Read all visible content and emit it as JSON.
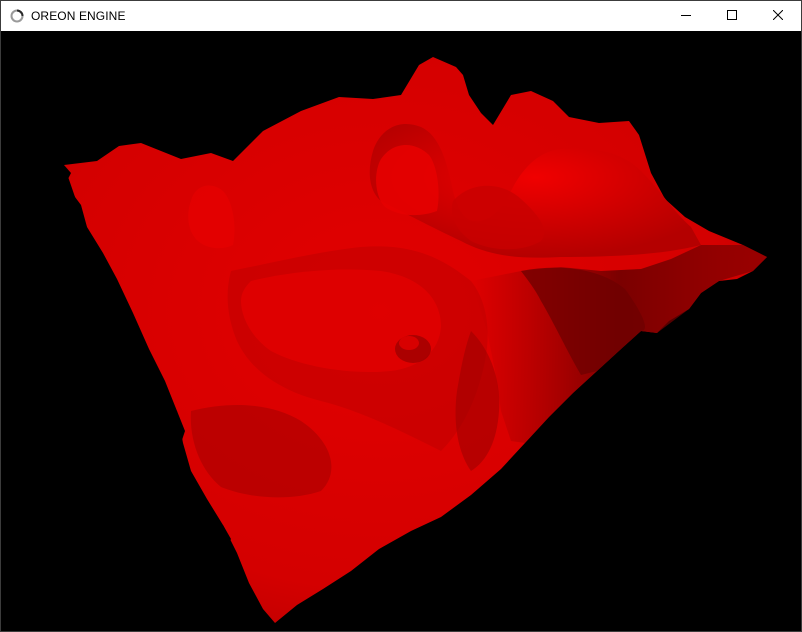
{
  "window": {
    "title": "OREON ENGINE",
    "icon": "app-loading-ring-icon",
    "controls": {
      "minimize": "minimize-icon",
      "maximize": "maximize-icon",
      "close": "close-icon"
    }
  },
  "viewport": {
    "background": "#000000",
    "scene": "red-terrain-mesh",
    "terrain_color": "#e00000"
  }
}
